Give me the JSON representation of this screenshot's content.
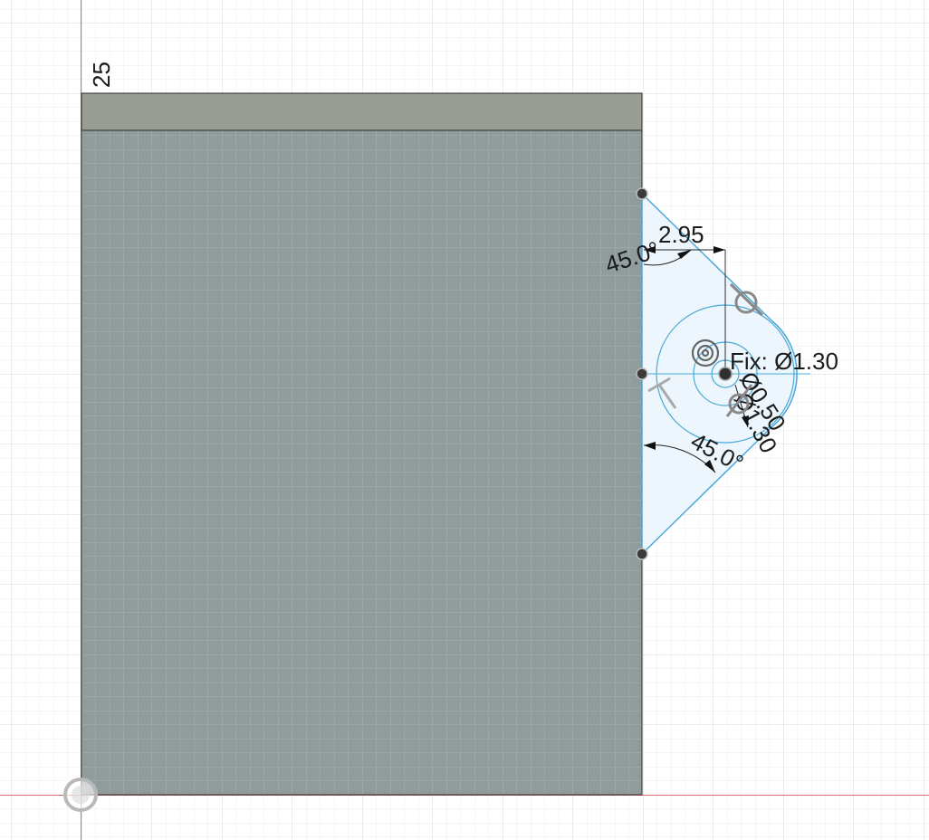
{
  "axis_number": "25",
  "dimensions": {
    "angle_top": "45.0°",
    "distance": "2.95",
    "diameter_fix": "Fix: Ø1.30",
    "diameter_small": "Ø0.50",
    "diameter_mid": "Ø1.30",
    "angle_bottom": "45.0°"
  },
  "colors": {
    "background": "#ffffff",
    "grid_minor": "#eeeeee",
    "grid_major": "#d9d9d9",
    "body_fill": "#8a9797",
    "body_top_fill": "#9a9c96",
    "sketch_line": "#4aa8d8",
    "sketch_fill": "#eaf4fb",
    "x_axis": "#d96a6a",
    "y_axis": "#58b058"
  },
  "icons": [
    "origin-icon",
    "tangent-constraint-icon",
    "concentric-constraint-icon",
    "perpendicular-constraint-icon"
  ]
}
